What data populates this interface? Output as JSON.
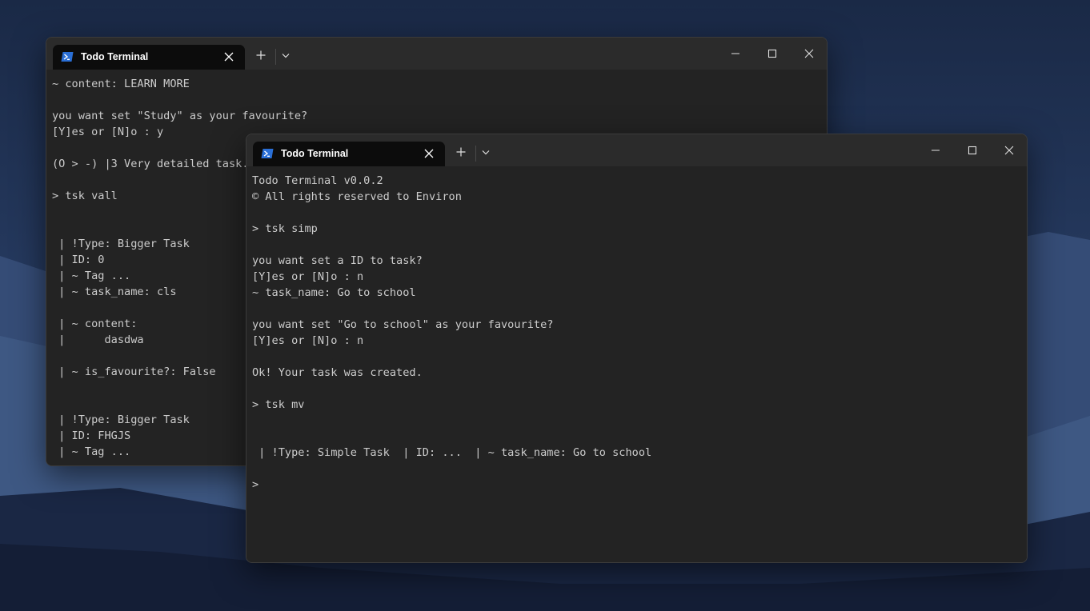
{
  "windows": {
    "back": {
      "tab_title": "Todo Terminal",
      "lines": [
        "~ content: LEARN MORE",
        "",
        "you want set \"Study\" as your favourite?",
        "[Y]es or [N]o : y",
        "",
        "(O > -) |3 Very detailed task.",
        "",
        "> tsk vall",
        "",
        "",
        " | !Type: Bigger Task",
        " | ID: 0",
        " | ~ Tag ...",
        " | ~ task_name: cls",
        "",
        " | ~ content:",
        " |      dasdwa",
        "",
        " | ~ is_favourite?: False",
        "",
        "",
        " | !Type: Bigger Task",
        " | ID: FHGJS",
        " | ~ Tag ..."
      ]
    },
    "front": {
      "tab_title": "Todo Terminal",
      "lines": [
        "Todo Terminal v0.0.2",
        "© All rights reserved to Environ",
        "",
        "> tsk simp",
        "",
        "you want set a ID to task?",
        "[Y]es or [N]o : n",
        "~ task_name: Go to school",
        "",
        "you want set \"Go to school\" as your favourite?",
        "[Y]es or [N]o : n",
        "",
        "Ok! Your task was created.",
        "",
        "> tsk mv",
        "",
        "",
        " | !Type: Simple Task  | ID: ...  | ~ task_name: Go to school",
        "",
        ">"
      ]
    }
  },
  "icons": {
    "tab_icon": "powershell-icon",
    "close": "close-icon",
    "new_tab": "plus-icon",
    "dropdown": "chevron-down-icon",
    "minimize": "minimize-icon",
    "maximize": "maximize-icon",
    "window_close": "close-icon"
  },
  "colors": {
    "terminal_bg": "#232323",
    "titlebar_bg": "#2b2b2b",
    "active_tab_bg": "#0c0c0c",
    "terminal_text": "#cccccc",
    "powershell_blue": "#2a6fd6"
  }
}
